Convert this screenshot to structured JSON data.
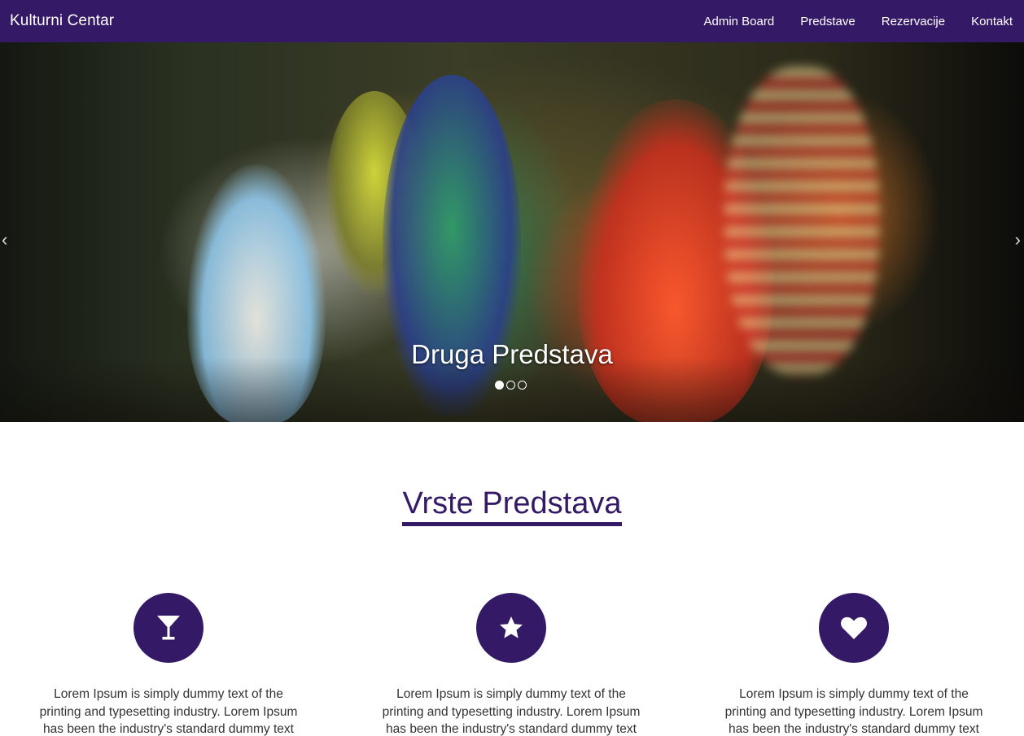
{
  "navbar": {
    "brand": "Kulturni Centar",
    "links": [
      "Admin Board",
      "Predstave",
      "Rezervacije",
      "Kontakt"
    ]
  },
  "carousel": {
    "caption": "Druga Predstava",
    "prev_icon": "‹",
    "next_icon": "›",
    "slide_count": 3,
    "active_index": 0
  },
  "section": {
    "title": "Vrste Predstava"
  },
  "features": [
    {
      "icon": "cocktail-glass-icon",
      "text": "Lorem Ipsum is simply dummy text of the printing and typesetting industry. Lorem Ipsum has been the industry's standard dummy text ever since"
    },
    {
      "icon": "star-icon",
      "text": "Lorem Ipsum is simply dummy text of the printing and typesetting industry. Lorem Ipsum has been the industry's standard dummy text ever since"
    },
    {
      "icon": "heart-icon",
      "text": "Lorem Ipsum is simply dummy text of the printing and typesetting industry. Lorem Ipsum has been the industry's standard dummy text ever since"
    }
  ],
  "colors": {
    "primary": "#341a66",
    "background": "#ffffff",
    "text": "#333333"
  }
}
